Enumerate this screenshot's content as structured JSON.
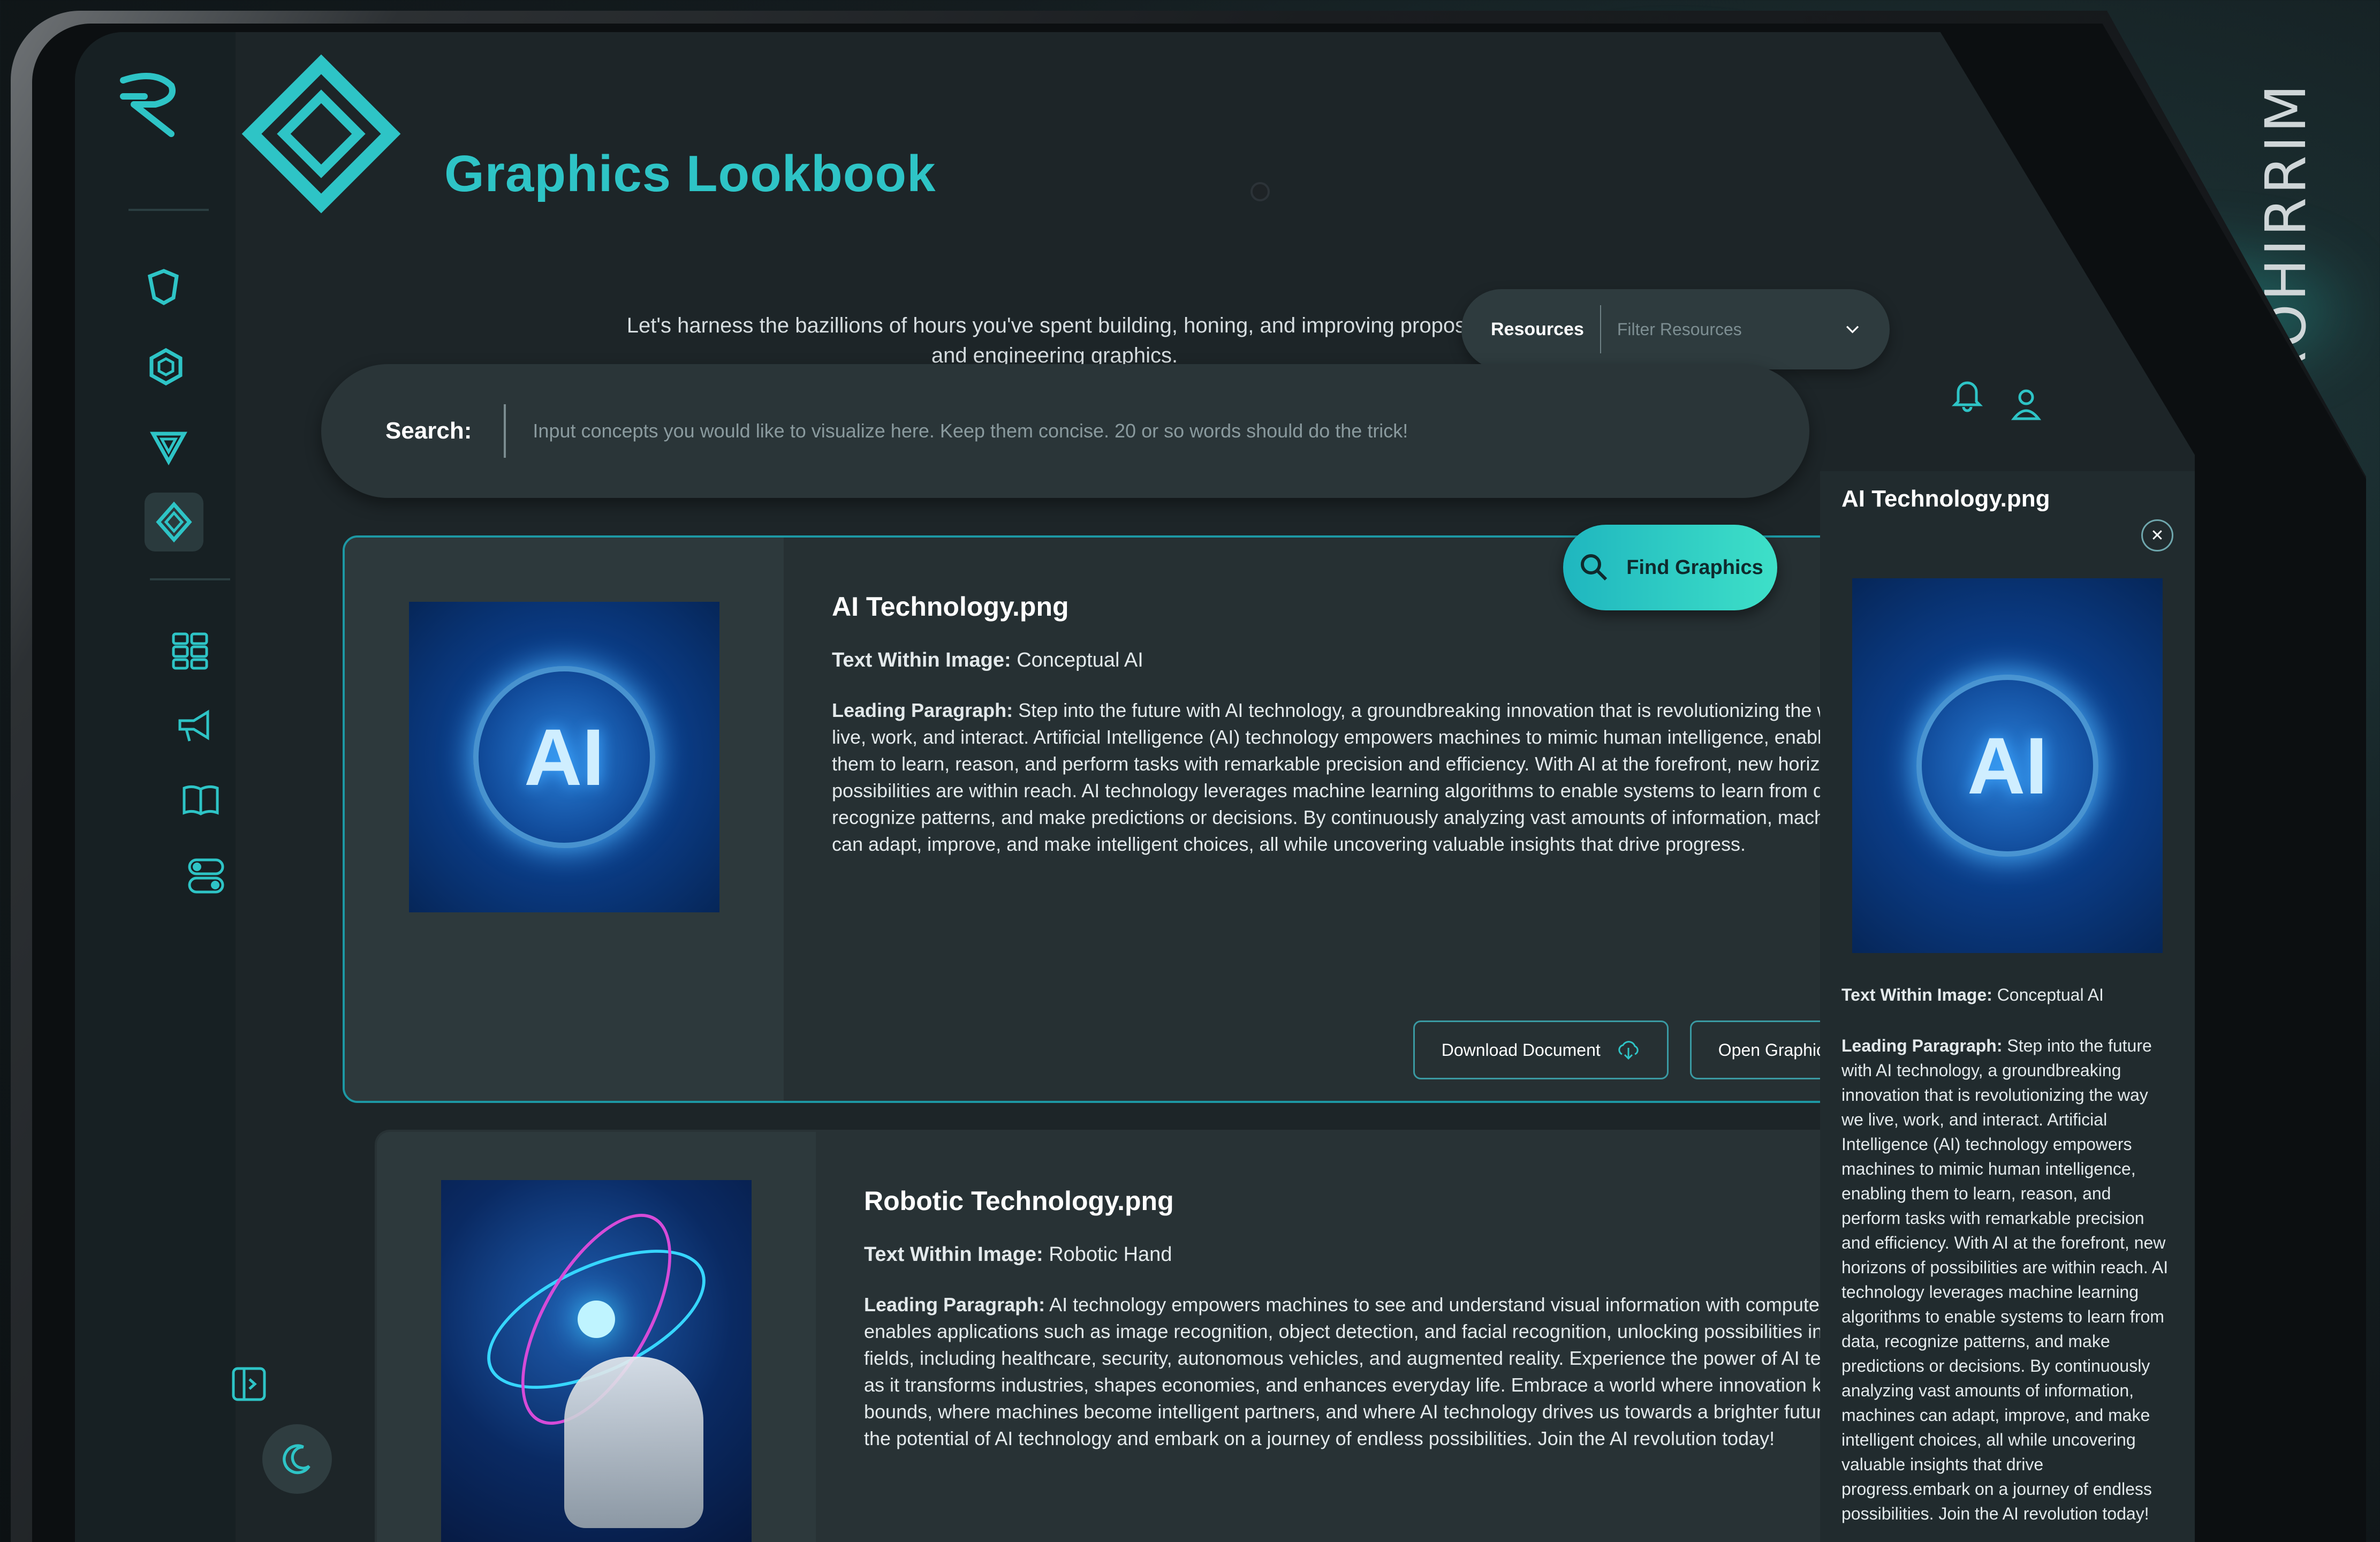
{
  "brand": {
    "watermark": "ROHIRRIM"
  },
  "header": {
    "title": "Graphics Lookbook",
    "tagline": "Let's harness the bazillions of hours you've spent building, honing, and improving proposal and engineering graphics."
  },
  "resources": {
    "label": "Resources",
    "placeholder": "Filter Resources"
  },
  "search": {
    "label": "Search:",
    "placeholder": "Input concepts you would like to visualize here. Keep them concise. 20 or so words should do the trick!",
    "button_label": "Find Graphics"
  },
  "sidebar": {
    "items": [
      {
        "icon": "angular-logo-icon"
      },
      {
        "icon": "hexagon-icon"
      },
      {
        "icon": "triangle-icon"
      },
      {
        "icon": "diamond-icon",
        "active": true
      },
      {
        "icon": "grid-icon"
      },
      {
        "icon": "megaphone-icon"
      },
      {
        "icon": "book-icon"
      },
      {
        "icon": "toggles-icon"
      }
    ]
  },
  "results": [
    {
      "title": "AI Technology.png",
      "text_label": "Text Within Image:",
      "text_value": "Conceptual AI",
      "para_label": "Leading Paragraph:",
      "para_value": "Step into the future with AI technology, a groundbreaking innovation that is revolutionizing the way we live, work, and interact. Artificial Intelligence (AI) technology empowers machines to mimic human intelligence, enabling them to learn, reason, and perform tasks with remarkable precision and efficiency. With AI at the forefront, new horizons of possibilities are within reach. AI technology leverages machine learning algorithms to enable systems to learn from data, recognize patterns, and make predictions or decisions. By continuously analyzing vast amounts of information, machines can adapt, improve, and make intelligent choices, all while uncovering valuable insights that drive progress.",
      "image_text": "AI",
      "download_label": "Download Document",
      "open_label": "Open Graphic"
    },
    {
      "title": "Robotic Technology.png",
      "text_label": "Text Within Image:",
      "text_value": "Robotic Hand",
      "para_label": "Leading Paragraph:",
      "para_value": "AI technology empowers machines to see and understand visual information with computer vision. It enables applications such as image recognition, object detection, and facial recognition, unlocking possibilities in various fields, including healthcare, security, autonomous vehicles, and augmented reality. Experience the power of AI technology as it transforms industries, shapes economies, and enhances everyday life. Embrace a world where innovation knows no bounds, where machines become intelligent partners, and where AI technology drives us towards a brighter future. Unlock the potential of AI technology and embark on a journey of endless possibilities. Join the AI revolution today!"
    }
  ],
  "preview": {
    "title": "AI Technology.png",
    "image_text": "AI",
    "text_label": "Text Within Image:",
    "text_value": "Conceptual AI",
    "para_label": "Leading Paragraph:",
    "para_value": "Step into the future with AI technology, a groundbreaking innovation that is revolutionizing the way we live, work, and interact. Artificial Intelligence (AI) technology empowers machines to mimic human intelligence, enabling them to learn, reason, and perform tasks with remarkable precision and efficiency. With AI at the forefront, new horizons of possibilities are within reach. AI technology leverages machine learning algorithms to enable systems to learn from data, recognize patterns, and make predictions or decisions. By continuously analyzing vast amounts of information, machines can adapt, improve, and make intelligent choices, all while uncovering valuable insights that drive progress.embark on a journey of endless possibilities. Join the AI revolution today!"
  },
  "colors": {
    "accent": "#2ec4c6",
    "accent_gradient_end": "#3ee0c8",
    "screen_bg": "#1d2528",
    "card_bg": "#263033",
    "card_border": "#1d98a4"
  }
}
